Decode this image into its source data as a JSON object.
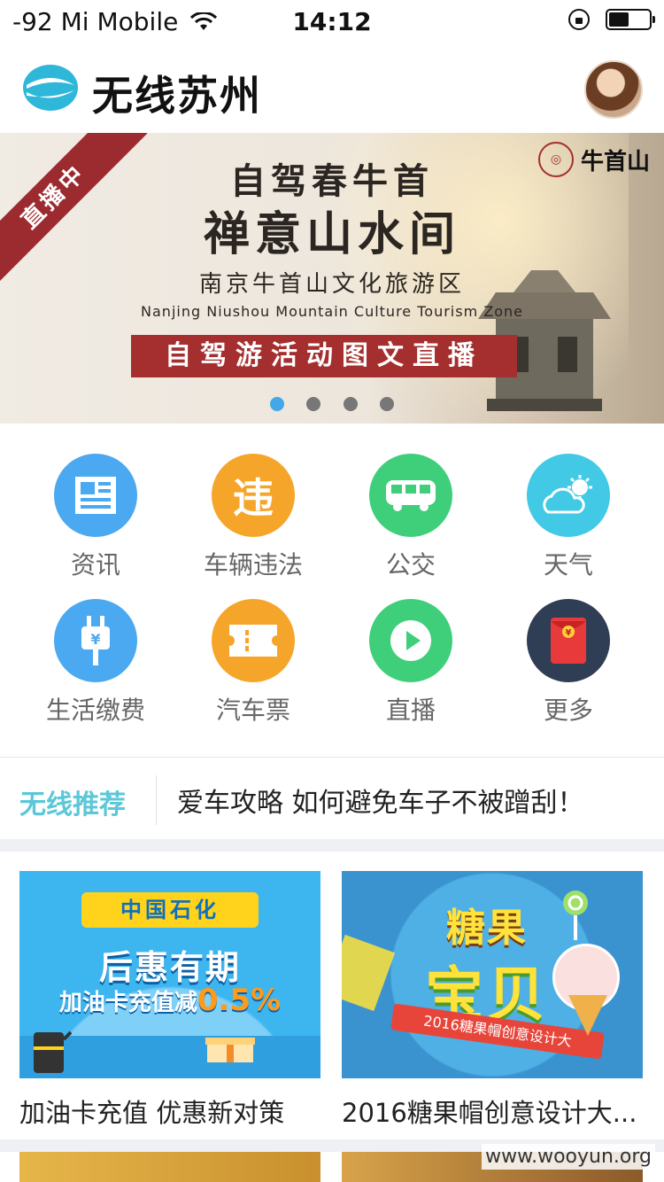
{
  "status_bar": {
    "carrier": "-92 Mi Mobile",
    "time": "14:12"
  },
  "header": {
    "app_title": "无线苏州"
  },
  "banner": {
    "live_badge": "直播中",
    "title_line1": "自驾春牛首",
    "title_line2": "禅意山水间",
    "subtitle_cn": "南京牛首山文化旅游区",
    "subtitle_en": "Nanjing Niushou Mountain Culture Tourism Zone",
    "cta_text": "自驾游活动图文直播",
    "brand_name": "牛首山",
    "active_slide": 1,
    "slide_count": 4
  },
  "quick_grid": {
    "items": [
      {
        "label": "资讯",
        "icon": "news-icon",
        "color": "#4aa9f0"
      },
      {
        "label": "车辆违法",
        "icon": "traffic-violation-icon",
        "color": "#f6a52b"
      },
      {
        "label": "公交",
        "icon": "bus-icon",
        "color": "#3fcf7a"
      },
      {
        "label": "天气",
        "icon": "weather-icon",
        "color": "#41c9e6"
      },
      {
        "label": "生活缴费",
        "icon": "utility-payment-icon",
        "color": "#4aa9f0"
      },
      {
        "label": "汽车票",
        "icon": "ticket-icon",
        "color": "#f6a52b"
      },
      {
        "label": "直播",
        "icon": "live-play-icon",
        "color": "#3fcf7a"
      },
      {
        "label": "更多",
        "icon": "more-redpacket-icon",
        "color": "#2f3e55"
      }
    ]
  },
  "recommend": {
    "tag": "无线推荐",
    "text": "爱车攻略 如何避免车子不被蹭刮！"
  },
  "cards": [
    {
      "caption": "加油卡充值 优惠新对策",
      "art_ribbon": "中国石化",
      "art_title": "后惠有期",
      "art_sub_prefix": "加油卡充值减",
      "art_sub_value": "0.5%"
    },
    {
      "caption": "2016糖果帽创意设计大...",
      "art_title1": "糖果",
      "art_title2": "宝贝",
      "art_band": "2016糖果帽创意设计大"
    }
  ],
  "watermark": "www.wooyun.org"
}
